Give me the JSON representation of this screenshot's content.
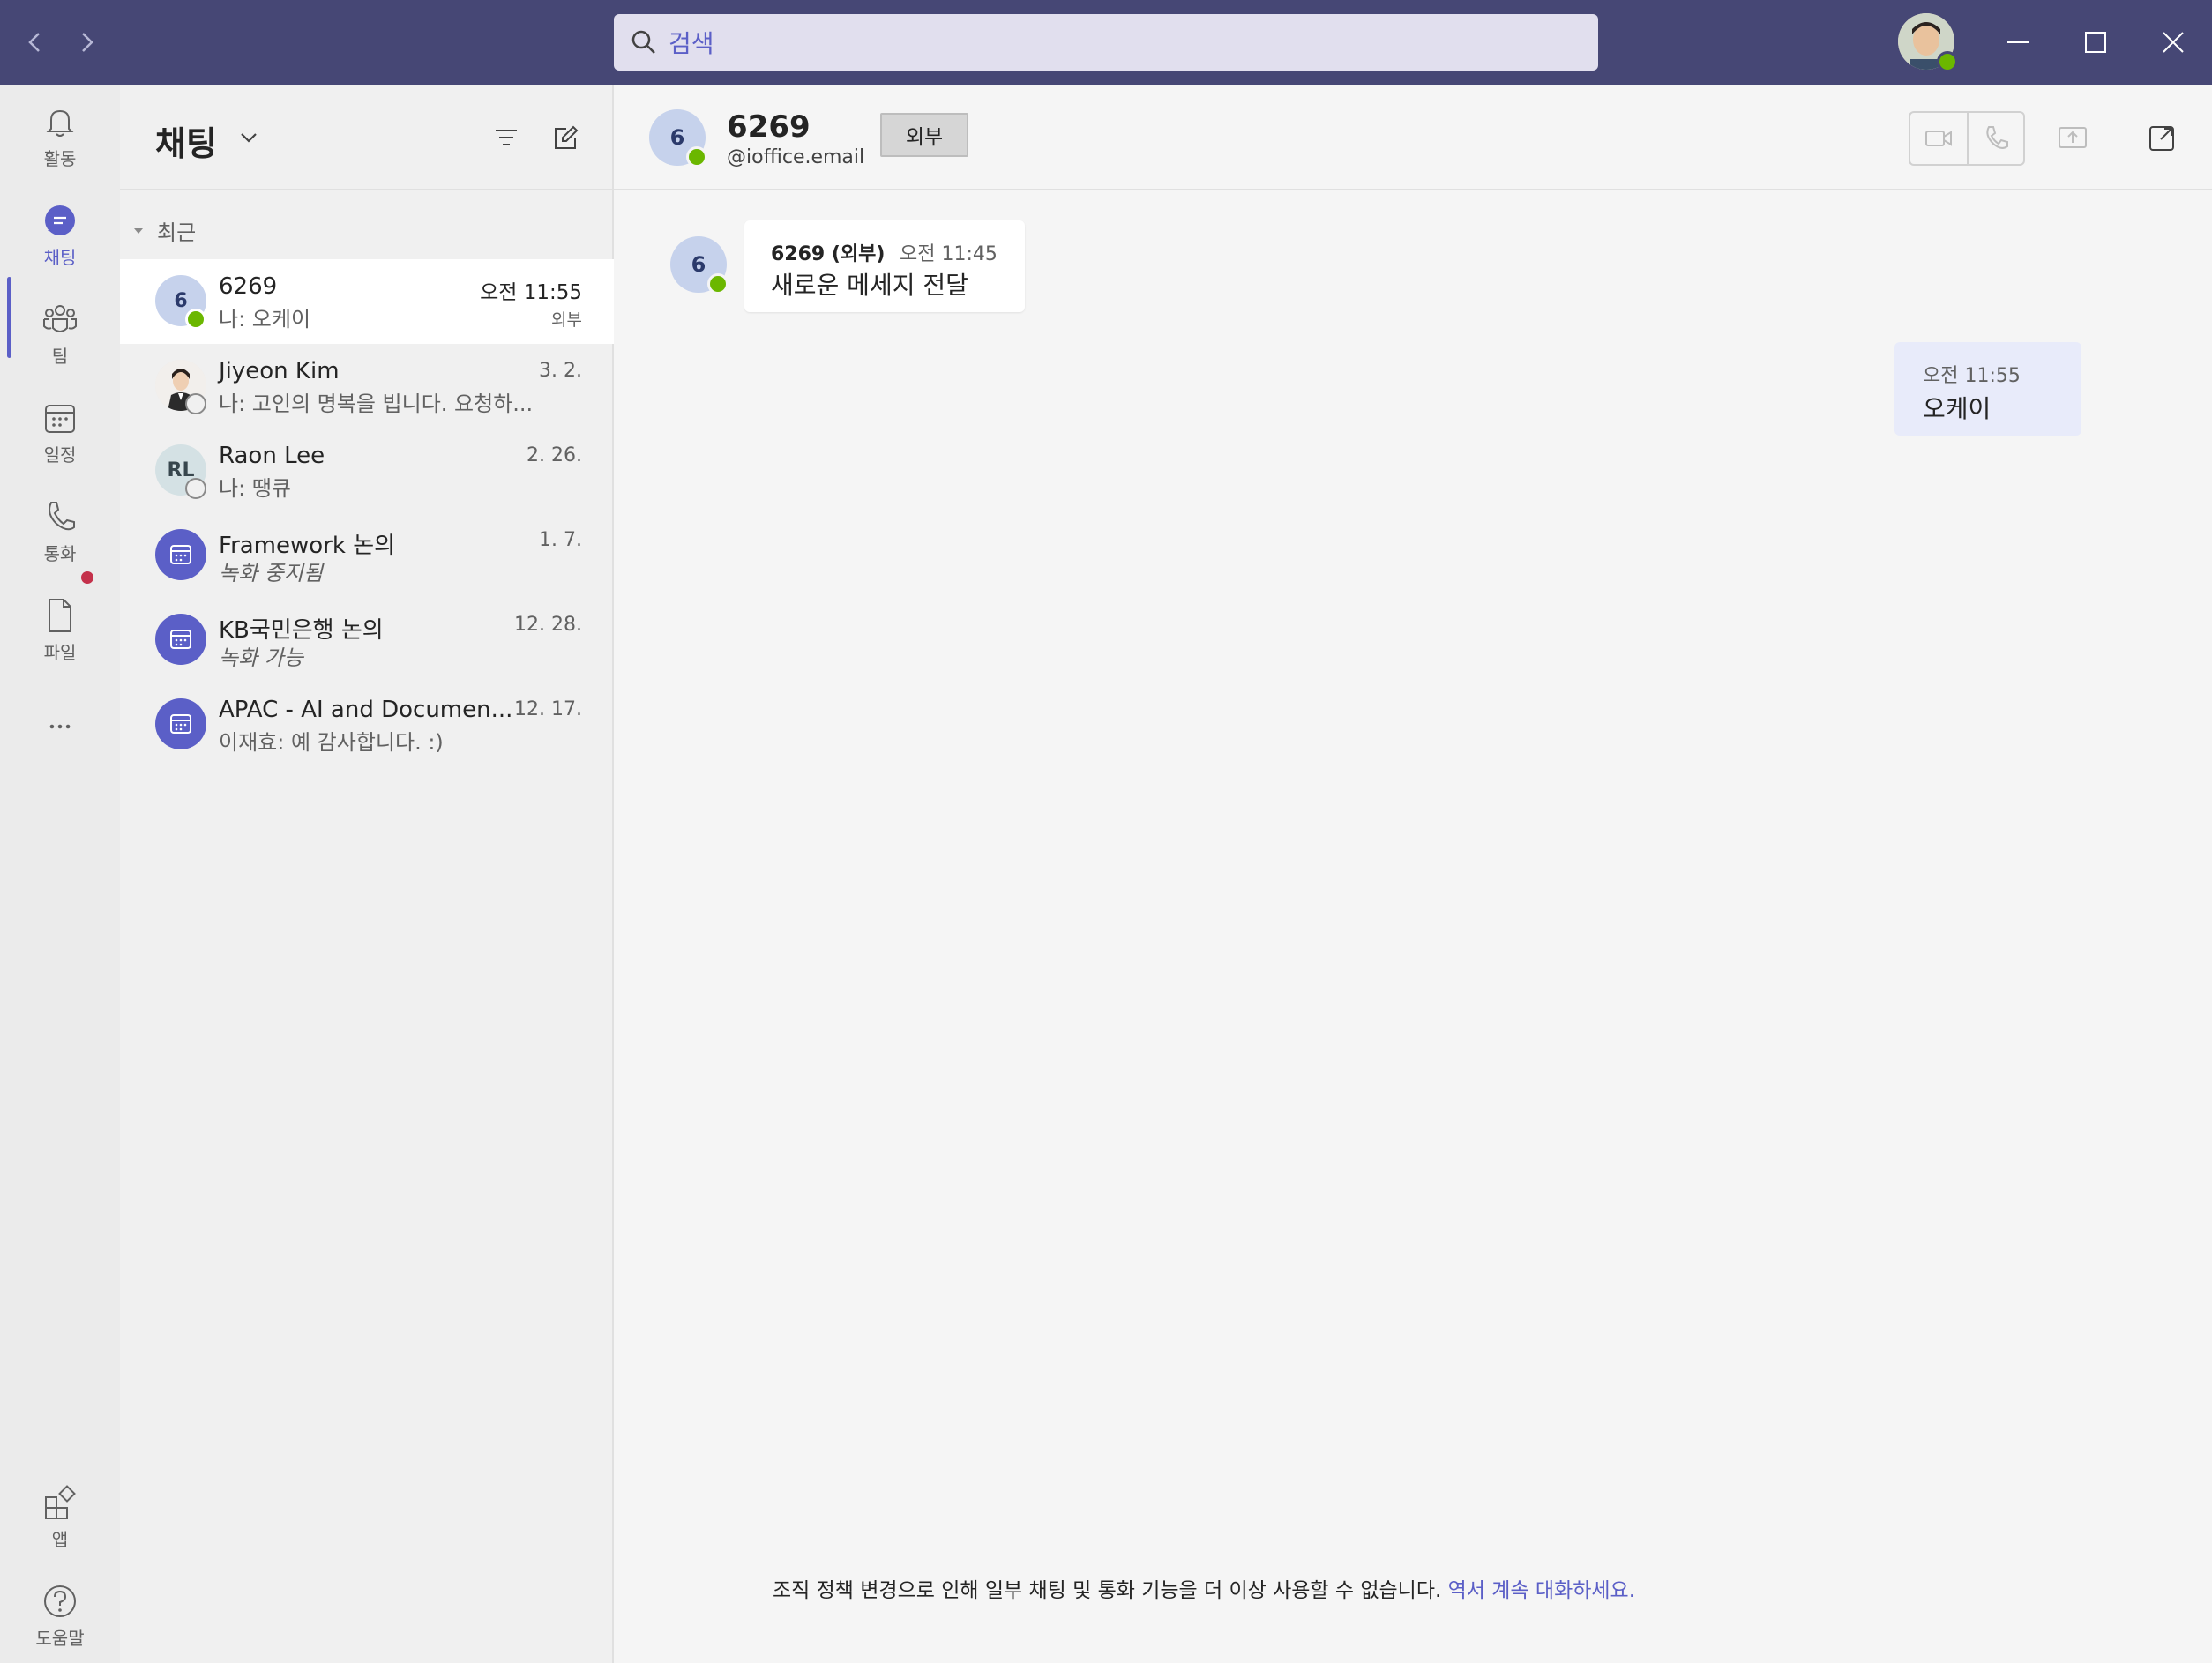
{
  "titlebar": {
    "search_placeholder": "검색",
    "back_icon": "chevron-left-icon",
    "forward_icon": "chevron-right-icon",
    "window_controls": [
      "minimize-icon",
      "maximize-icon",
      "close-icon"
    ],
    "brand_color": "#464775"
  },
  "rail": {
    "items": [
      {
        "label": "활동",
        "icon": "bell-icon"
      },
      {
        "label": "채팅",
        "icon": "chat-icon",
        "active": true
      },
      {
        "label": "팀",
        "icon": "teams-icon"
      },
      {
        "label": "일정",
        "icon": "calendar-icon"
      },
      {
        "label": "통화",
        "icon": "phone-icon",
        "has_notification": true
      },
      {
        "label": "파일",
        "icon": "file-icon"
      }
    ],
    "more_icon": "more-icon",
    "bottom": [
      {
        "label": "앱",
        "icon": "apps-icon"
      },
      {
        "label": "도움말",
        "icon": "help-icon"
      }
    ],
    "accent": "#5b5fc7"
  },
  "chatlist": {
    "title": "채팅",
    "section": "최근",
    "chats": [
      {
        "name": "6269",
        "preview": "나: 오케이",
        "time": "오전 11:55",
        "badge": "외부",
        "avatar": "6",
        "status": "available"
      },
      {
        "name": "Jiyeon Kim",
        "preview": "나: 고인의 명복을 빕니다. 요청하...",
        "time": "3. 2.",
        "avatar": "photo",
        "status": "offline"
      },
      {
        "name": "Raon Lee",
        "preview": "나: 땡큐",
        "time": "2. 26.",
        "avatar": "RL",
        "status": "offline"
      },
      {
        "name": "Framework 논의",
        "preview": "녹화 중지됨",
        "time": "1. 7.",
        "avatar": "meeting"
      },
      {
        "name": "KB국민은행 논의",
        "preview": "녹화 가능",
        "time": "12. 28.",
        "avatar": "meeting"
      },
      {
        "name": "APAC - AI and Documen...",
        "preview": "이재효: 예 감사합니다. :)",
        "time": "12. 17.",
        "avatar": "meeting"
      }
    ]
  },
  "conversation": {
    "contact_initial": "6",
    "contact_name": "6269",
    "contact_email": "@ioffice.email",
    "external_label": "외부",
    "messages": [
      {
        "direction": "in",
        "sender": "6269 (외부)",
        "time": "오전 11:45",
        "text": "새로운 메세지 전달"
      },
      {
        "direction": "out",
        "time": "오전 11:55",
        "text": "오케이"
      }
    ],
    "policy_text": "조직 정책 변경으로 인해 일부 채팅 및 통화 기능을 더 이상 사용할 수 없습니다.",
    "policy_link": "역서 계속 대화하세요."
  }
}
